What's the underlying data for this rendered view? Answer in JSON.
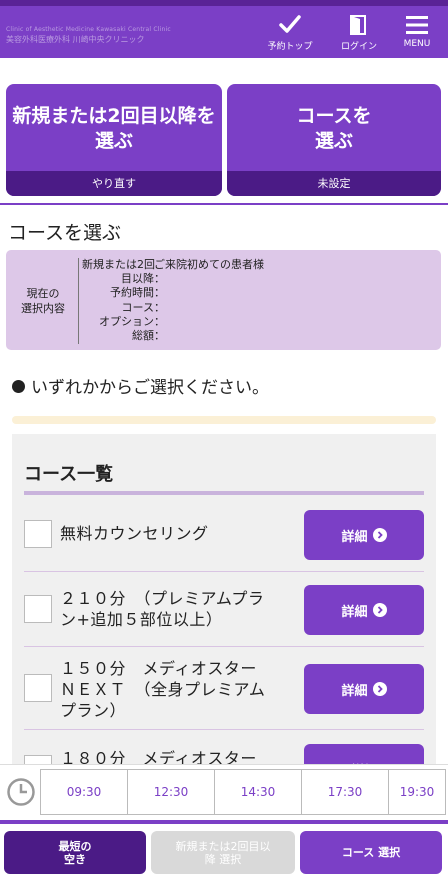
{
  "header": {
    "clinic_name_en": "Clinic of Aesthetic Medicine Kawasaki Central Clinic",
    "clinic_name_ja": "美容外科医療外科 川崎中央クリニック",
    "reservation_top_label": "予約トップ",
    "login_label": "ログイン",
    "menu_label": "MENU"
  },
  "cards": [
    {
      "title_line1": "新規または2回目以降を",
      "title_line2": "選ぶ",
      "footer": "やり直す"
    },
    {
      "title_line1": "コースを",
      "title_line2": "選ぶ",
      "footer": "未設定"
    }
  ],
  "section_title": "コースを選ぶ",
  "summary": {
    "label_line1": "現在の",
    "label_line2": "選択内容",
    "rows": [
      {
        "key": "新規または2回",
        "value": "ご来院初めての患者様"
      },
      {
        "key": "目以降",
        "value": ""
      },
      {
        "key": "予約時間",
        "value": ""
      },
      {
        "key": "コース",
        "value": ""
      },
      {
        "key": "オプション",
        "value": ""
      },
      {
        "key": "総額",
        "value": ""
      }
    ]
  },
  "notice": "いずれかからご選択ください。",
  "course_list": {
    "title": "コース一覧",
    "detail_label": "詳細",
    "courses": [
      {
        "line1": "無料カウンセリング",
        "line2": "",
        "line3": ""
      },
      {
        "line1": "２１０分　（プレミアムプラ",
        "line2": "ン+追加５部位以上）",
        "line3": ""
      },
      {
        "line1": "１５０分　メディオスター",
        "line2": "ＮＥＸＴ　（全身プレミアム",
        "line3": "プラン）"
      },
      {
        "line1": "１８０分　メディオスター",
        "line2": "",
        "line3": ""
      }
    ]
  },
  "time_slots": [
    "09:30",
    "12:30",
    "14:30",
    "17:30",
    "19:30"
  ],
  "bottom": {
    "earliest_line1": "最短の",
    "earliest_line2": "空き",
    "new_or_second_line1": "新規または2回目以",
    "new_or_second_line2": "降 選択",
    "course_select": "コース 選択"
  },
  "colors": {
    "primary": "#7b3fc6",
    "dark": "#4b1b86",
    "summary_bg": "#ddc8e8",
    "disabled": "#d9d9d9"
  }
}
